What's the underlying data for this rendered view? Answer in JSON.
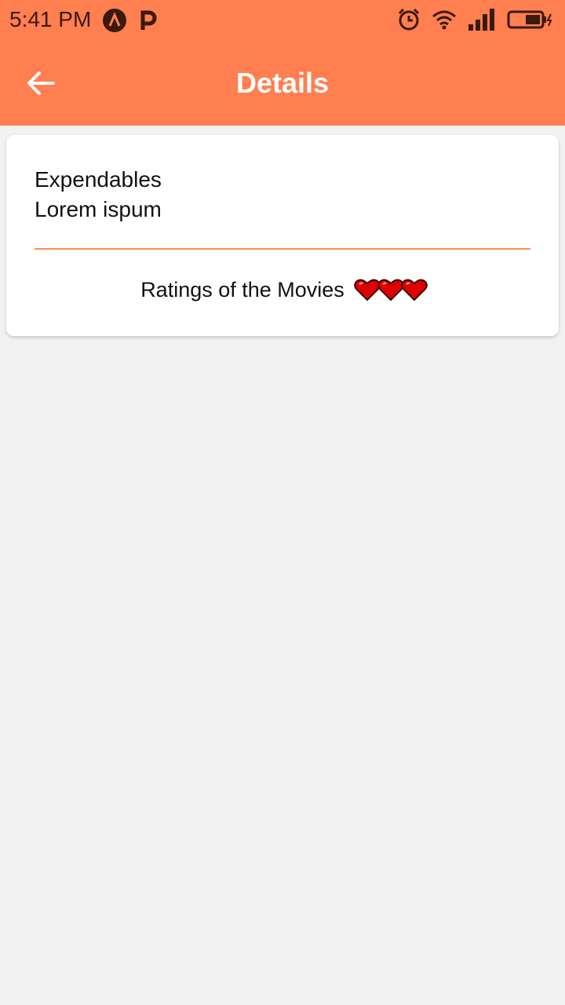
{
  "status_bar": {
    "time": "5:41 PM",
    "left_icons": [
      "app-a-icon",
      "app-p-icon"
    ],
    "right_icons": [
      "alarm-icon",
      "wifi-icon",
      "signal-icon",
      "battery-charging-icon"
    ]
  },
  "header": {
    "title": "Details",
    "back_icon": "arrow-left-icon"
  },
  "card": {
    "title": "Expendables",
    "subtitle": "Lorem ispum",
    "rating_label": "Ratings of the Movies",
    "rating_hearts": 3,
    "divider_color": "#f0925d"
  },
  "colors": {
    "header_bg": "#ff7f50",
    "page_bg": "#f2f2f2",
    "heart": "#e00000"
  }
}
